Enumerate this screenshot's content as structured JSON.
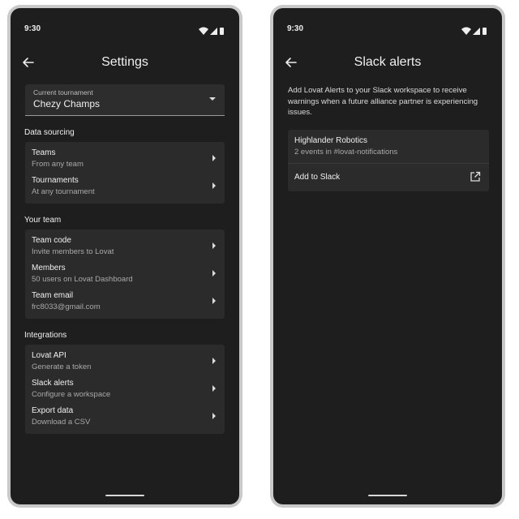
{
  "status": {
    "time": "9:30"
  },
  "settings": {
    "title": "Settings",
    "tournament": {
      "label": "Current tournament",
      "value": "Chezy Champs"
    },
    "sections": [
      {
        "title": "Data sourcing",
        "items": [
          {
            "title": "Teams",
            "subtitle": "From any team"
          },
          {
            "title": "Tournaments",
            "subtitle": "At any tournament"
          }
        ]
      },
      {
        "title": "Your team",
        "items": [
          {
            "title": "Team code",
            "subtitle": "Invite members to Lovat"
          },
          {
            "title": "Members",
            "subtitle": "50 users on Lovat Dashboard"
          },
          {
            "title": "Team email",
            "subtitle": "frc8033@gmail.com"
          }
        ]
      },
      {
        "title": "Integrations",
        "items": [
          {
            "title": "Lovat API",
            "subtitle": "Generate a token"
          },
          {
            "title": "Slack alerts",
            "subtitle": "Configure a workspace"
          },
          {
            "title": "Export data",
            "subtitle": "Download a CSV"
          }
        ]
      }
    ]
  },
  "slack": {
    "title": "Slack alerts",
    "description": "Add Lovat Alerts to your Slack workspace to receive warnings when a future alliance partner is experiencing issues.",
    "workspace": {
      "name": "Highlander Robotics",
      "events": "2 events in #lovat-notifications"
    },
    "add_label": "Add to Slack"
  },
  "icons": {
    "back": "arrow-left-icon",
    "dropdown": "caret-down-icon",
    "row": "chevron-right-icon",
    "external": "open-in-new-icon"
  },
  "colors": {
    "background": "#1e1e1f",
    "card": "#2b2b2c",
    "frame": "#c9c9c9"
  }
}
